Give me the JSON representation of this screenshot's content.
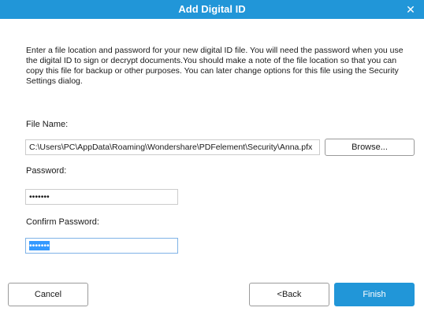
{
  "dialog": {
    "title": "Add Digital ID",
    "close_glyph": "✕",
    "description": "Enter a file location and password for your new digital ID file. You will need the password when you use the digital ID to sign or decrypt documents.You should make a note of the file location so that you can copy this file for backup or other purposes. You can later change options for this file using the Security Settings dialog."
  },
  "file_name": {
    "label": "File Name:",
    "value": "C:\\Users\\PC\\AppData\\Roaming\\Wondershare\\PDFelement\\Security\\Anna.pfx",
    "browse_label": "Browse..."
  },
  "password": {
    "label": "Password:",
    "value": "•••••••"
  },
  "confirm_password": {
    "label": "Confirm Password:",
    "value": "•••••••"
  },
  "buttons": {
    "cancel": "Cancel",
    "back": "<Back",
    "finish": "Finish"
  },
  "colors": {
    "accent": "#2196d8",
    "selection": "#3399ff"
  }
}
